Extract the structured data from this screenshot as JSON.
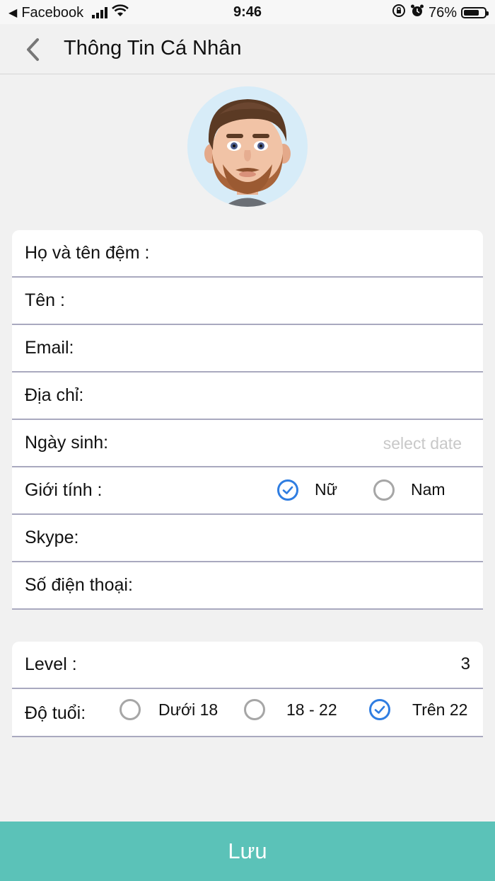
{
  "status_bar": {
    "back_app": "Facebook",
    "time": "9:46",
    "battery_percent": "76%",
    "battery_level": 0.76
  },
  "header": {
    "title": "Thông Tin Cá Nhân",
    "back_icon": "chevron-left-icon"
  },
  "profile": {
    "avatar": "memoji-avatar"
  },
  "form": {
    "fields": [
      {
        "label": "Họ và tên đệm :",
        "value": ""
      },
      {
        "label": "Tên :",
        "value": ""
      },
      {
        "label": "Email:",
        "value": ""
      },
      {
        "label": "Địa chỉ:",
        "value": ""
      }
    ],
    "birthday": {
      "label": "Ngày sinh:",
      "placeholder": "select date"
    },
    "gender": {
      "label": "Giới tính :",
      "options": [
        {
          "label": "Nữ",
          "selected": true
        },
        {
          "label": "Nam",
          "selected": false
        }
      ]
    },
    "skype": {
      "label": "Skype:",
      "value": ""
    },
    "phone": {
      "label": "Số điện thoại:",
      "value": ""
    }
  },
  "extra": {
    "level": {
      "label": "Level :",
      "value": "3"
    },
    "age": {
      "label": "Độ tuổi:",
      "options": [
        {
          "label": "Dưới 18",
          "selected": false
        },
        {
          "label": "18 - 22",
          "selected": false
        },
        {
          "label": "Trên 22",
          "selected": true
        }
      ]
    }
  },
  "actions": {
    "save_label": "Lưu"
  },
  "colors": {
    "accent": "#2f7de1",
    "save_button": "#5bc2b8",
    "background": "#f1f1f1"
  }
}
